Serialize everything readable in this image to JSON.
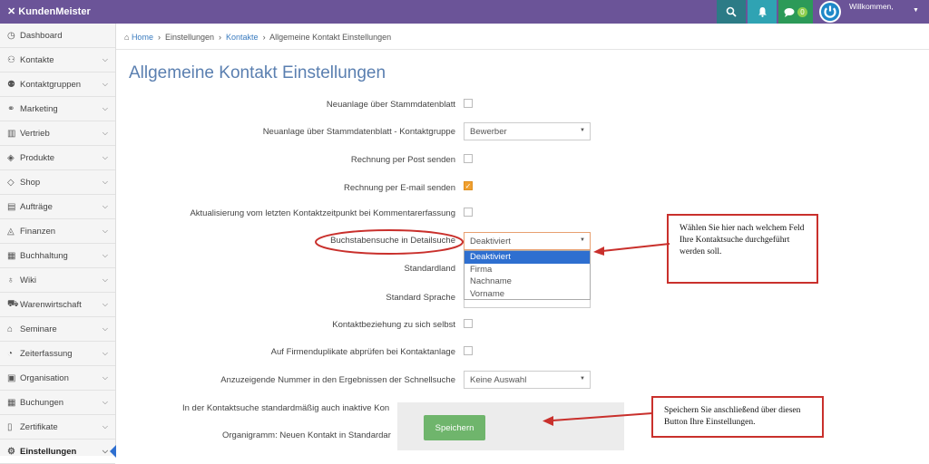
{
  "topbar": {
    "brand": "KundenMeister",
    "badge_count": "0",
    "welcome": "Willkommen,",
    "colors": {
      "bar": "#6b5498",
      "search": "#2c7b86",
      "notify": "#2fa3b3",
      "messages": "#2c9a58",
      "badge": "#8fcf4f"
    },
    "icons": [
      "search-icon",
      "bell-icon",
      "chat-icon",
      "power-icon",
      "caret-down-icon"
    ]
  },
  "sidebar": {
    "items": [
      {
        "label": "Dashboard",
        "icon": "dashboard-icon",
        "glyph": "◷",
        "chevron": false
      },
      {
        "label": "Kontakte",
        "icon": "contacts-icon",
        "glyph": "⚇",
        "chevron": true
      },
      {
        "label": "Kontaktgruppen",
        "icon": "group-icon",
        "glyph": "⚉",
        "chevron": true
      },
      {
        "label": "Marketing",
        "icon": "marketing-icon",
        "glyph": "⚭",
        "chevron": true
      },
      {
        "label": "Vertrieb",
        "icon": "chart-icon",
        "glyph": "▥",
        "chevron": true
      },
      {
        "label": "Produkte",
        "icon": "box-icon",
        "glyph": "◈",
        "chevron": true
      },
      {
        "label": "Shop",
        "icon": "tag-icon",
        "glyph": "◇",
        "chevron": true
      },
      {
        "label": "Aufträge",
        "icon": "orders-icon",
        "glyph": "▤",
        "chevron": true
      },
      {
        "label": "Finanzen",
        "icon": "money-icon",
        "glyph": "◬",
        "chevron": true
      },
      {
        "label": "Buchhaltung",
        "icon": "ledger-icon",
        "glyph": "▦",
        "chevron": true
      },
      {
        "label": "Wiki",
        "icon": "bulb-icon",
        "glyph": "♁",
        "chevron": true
      },
      {
        "label": "Warenwirtschaft",
        "icon": "cart-icon",
        "glyph": "⛟",
        "chevron": true
      },
      {
        "label": "Seminare",
        "icon": "graduation-icon",
        "glyph": "⌂",
        "chevron": true
      },
      {
        "label": "Zeiterfassung",
        "icon": "clock-icon",
        "glyph": "◔",
        "chevron": true
      },
      {
        "label": "Organisation",
        "icon": "clipboard-icon",
        "glyph": "▣",
        "chevron": true
      },
      {
        "label": "Buchungen",
        "icon": "calendar-icon",
        "glyph": "▦",
        "chevron": true
      },
      {
        "label": "Zertifikate",
        "icon": "bookmark-icon",
        "glyph": "▯",
        "chevron": true
      },
      {
        "label": "Einstellungen",
        "icon": "gear-icon",
        "glyph": "⚙",
        "chevron": true,
        "active": true
      }
    ]
  },
  "breadcrumb": {
    "home": "Home",
    "settings": "Einstellungen",
    "contacts": "Kontakte",
    "current": "Allgemeine Kontakt Einstellungen"
  },
  "page_title": "Allgemeine Kontakt Einstellungen",
  "form": {
    "new_via_master": "Neuanlage über Stammdatenblatt",
    "new_via_master_group": "Neuanlage über Stammdatenblatt - Kontaktgruppe",
    "new_via_master_group_value": "Bewerber",
    "invoice_post": "Rechnung per Post senden",
    "invoice_email": "Rechnung per E-mail senden",
    "update_contact_time": "Aktualisierung vom letzten Kontaktzeitpunkt bei Kommentarerfassung",
    "letter_search": "Buchstabensuche in Detailsuche",
    "letter_search_value": "Deaktiviert",
    "letter_search_options": [
      "Deaktiviert",
      "Firma",
      "Nachname",
      "Vorname"
    ],
    "default_country": "Standardland",
    "default_language": "Standard Sprache",
    "self_relation": "Kontaktbeziehung zu sich selbst",
    "duplicate_check": "Auf Firmenduplikate abprüfen bei Kontaktanlage",
    "quick_search_number": "Anzuzeigende Nummer in den Ergebnissen der Schnellsuche",
    "quick_search_number_value": "Keine Auswahl",
    "inactive_contacts": "In der Kontaktsuche standardmäßig auch inaktive Kon",
    "org_chart": "Organigramm: Neuen Kontakt in Standardar"
  },
  "save_button": "Speichern",
  "callouts": {
    "dropdown": "Wählen Sie hier nach welchem Feld Ihre Kontaktsuche durchgeführt werden soll.",
    "save": "Speichern Sie anschließend über diesen Button Ihre Einstellungen."
  },
  "colors": {
    "accent_red": "#c9302c",
    "title_blue": "#5a7fb0",
    "checkbox_on": "#f0a030",
    "save_green": "#6fb56c"
  }
}
